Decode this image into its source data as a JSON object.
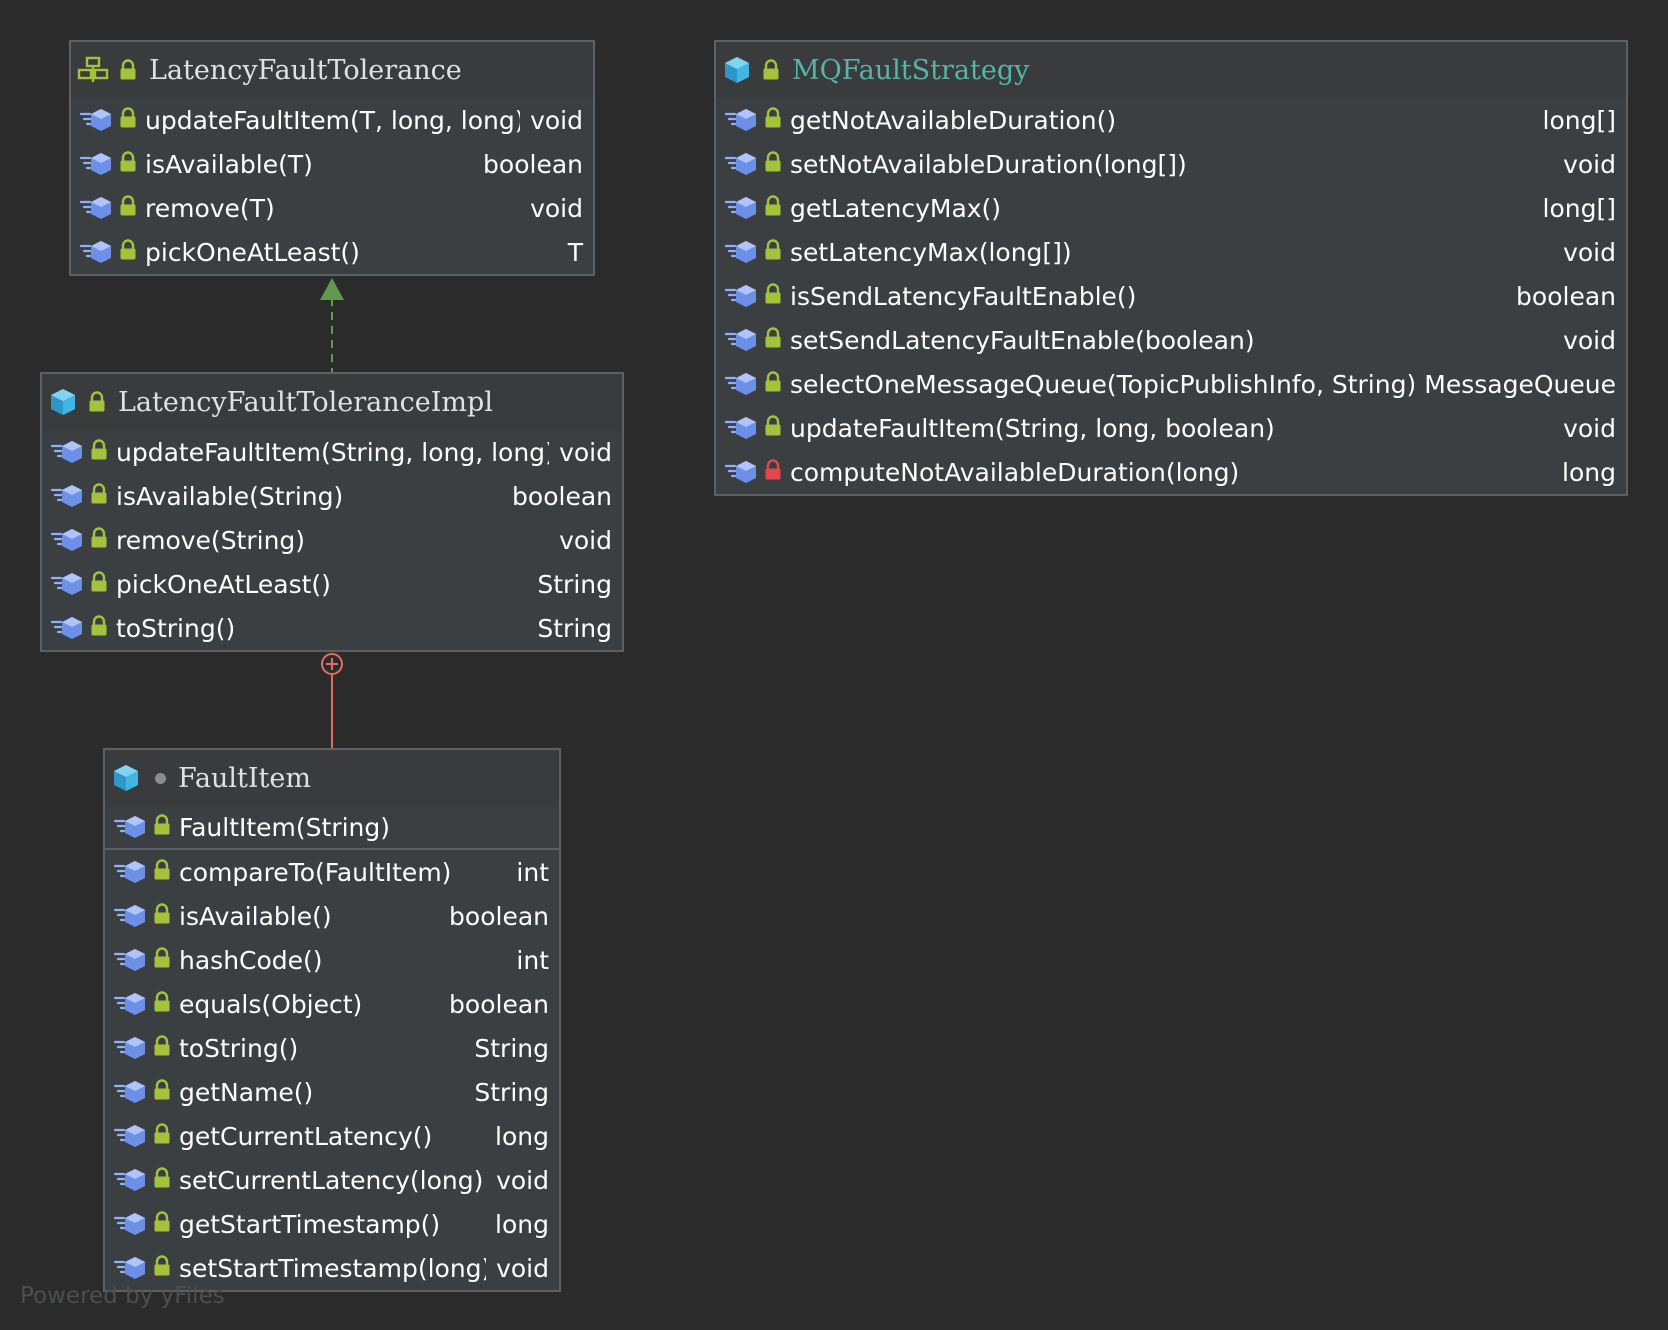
{
  "nodes": [
    {
      "id": "latency-fault-tolerance",
      "kind": "interface",
      "title": "LatencyFaultTolerance",
      "title_accent": false,
      "constructors": [],
      "methods": [
        {
          "name": "updateFaultItem(T, long, long)",
          "type": "void",
          "lock": "green"
        },
        {
          "name": "isAvailable(T)",
          "type": "boolean",
          "lock": "green"
        },
        {
          "name": "remove(T)",
          "type": "void",
          "lock": "green"
        },
        {
          "name": "pickOneAtLeast()",
          "type": "T",
          "lock": "green"
        }
      ]
    },
    {
      "id": "latency-fault-tolerance-impl",
      "kind": "class",
      "title": "LatencyFaultToleranceImpl",
      "title_accent": false,
      "constructors": [],
      "methods": [
        {
          "name": "updateFaultItem(String, long, long)",
          "type": "void",
          "lock": "green"
        },
        {
          "name": "isAvailable(String)",
          "type": "boolean",
          "lock": "green"
        },
        {
          "name": "remove(String)",
          "type": "void",
          "lock": "green"
        },
        {
          "name": "pickOneAtLeast()",
          "type": "String",
          "lock": "green"
        },
        {
          "name": "toString()",
          "type": "String",
          "lock": "green"
        }
      ]
    },
    {
      "id": "fault-item",
      "kind": "class-package",
      "title": "FaultItem",
      "title_accent": false,
      "constructors": [
        {
          "name": "FaultItem(String)",
          "type": "",
          "lock": "green"
        }
      ],
      "methods": [
        {
          "name": "compareTo(FaultItem)",
          "type": "int",
          "lock": "green"
        },
        {
          "name": "isAvailable()",
          "type": "boolean",
          "lock": "green"
        },
        {
          "name": "hashCode()",
          "type": "int",
          "lock": "green"
        },
        {
          "name": "equals(Object)",
          "type": "boolean",
          "lock": "green"
        },
        {
          "name": "toString()",
          "type": "String",
          "lock": "green"
        },
        {
          "name": "getName()",
          "type": "String",
          "lock": "green"
        },
        {
          "name": "getCurrentLatency()",
          "type": "long",
          "lock": "green"
        },
        {
          "name": "setCurrentLatency(long)",
          "type": "void",
          "lock": "green"
        },
        {
          "name": "getStartTimestamp()",
          "type": "long",
          "lock": "green"
        },
        {
          "name": "setStartTimestamp(long)",
          "type": "void",
          "lock": "green"
        }
      ]
    },
    {
      "id": "mq-fault-strategy",
      "kind": "class",
      "title": "MQFaultStrategy",
      "title_accent": true,
      "constructors": [],
      "methods": [
        {
          "name": "getNotAvailableDuration()",
          "type": "long[]",
          "lock": "green"
        },
        {
          "name": "setNotAvailableDuration(long[])",
          "type": "void",
          "lock": "green"
        },
        {
          "name": "getLatencyMax()",
          "type": "long[]",
          "lock": "green"
        },
        {
          "name": "setLatencyMax(long[])",
          "type": "void",
          "lock": "green"
        },
        {
          "name": "isSendLatencyFaultEnable()",
          "type": "boolean",
          "lock": "green"
        },
        {
          "name": "setSendLatencyFaultEnable(boolean)",
          "type": "void",
          "lock": "green"
        },
        {
          "name": "selectOneMessageQueue(TopicPublishInfo, String)",
          "type": "MessageQueue",
          "lock": "green"
        },
        {
          "name": "updateFaultItem(String, long, boolean)",
          "type": "void",
          "lock": "green"
        },
        {
          "name": "computeNotAvailableDuration(long)",
          "type": "long",
          "lock": "red"
        }
      ]
    }
  ],
  "edges": [
    {
      "from": "latency-fault-tolerance-impl",
      "to": "latency-fault-tolerance",
      "kind": "implements"
    },
    {
      "from": "fault-item",
      "to": "latency-fault-tolerance-impl",
      "kind": "inner-class"
    }
  ],
  "colors": {
    "background": "#2b2b2b",
    "node_fill": "#3c3f41",
    "node_border": "#5e6163",
    "text": "#ffffff",
    "title_accent": "#55b5a6",
    "implements_edge": "#5f9a4f",
    "inner_edge": "#e06c64",
    "lock_green": "#a4c23c",
    "lock_red": "#e0494b",
    "class_icon": "#40b6e0",
    "interface_icon": "#a4c23c"
  },
  "footer": "Powered by yFiles"
}
